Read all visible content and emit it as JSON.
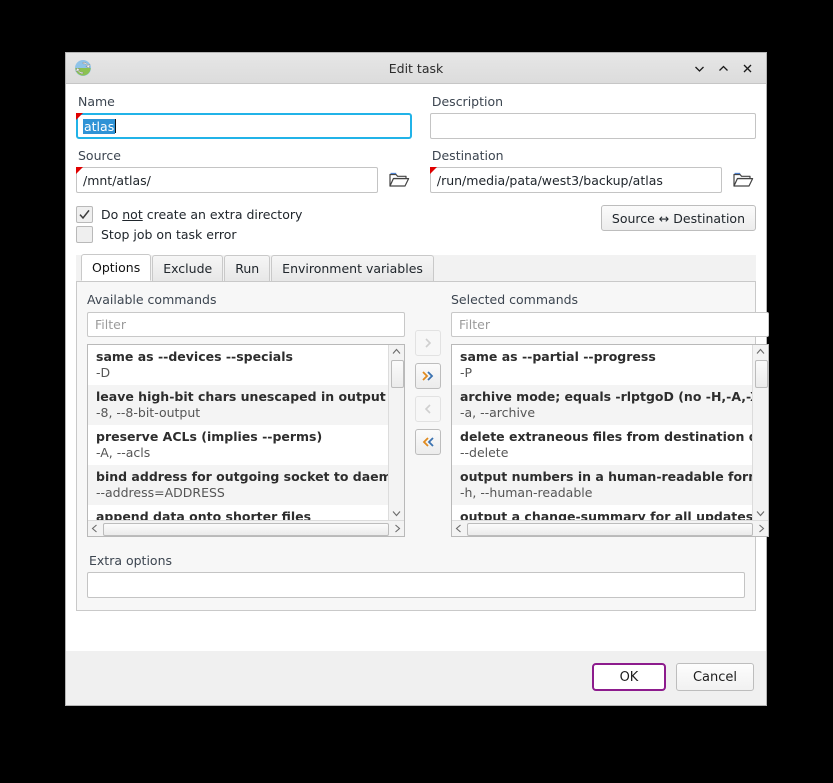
{
  "window": {
    "title": "Edit task",
    "icon": "sync-icon",
    "controls": [
      {
        "name": "minimize-button",
        "icon": "chevron-down-icon"
      },
      {
        "name": "maximize-button",
        "icon": "chevron-up-icon"
      },
      {
        "name": "close-button",
        "icon": "close-icon"
      }
    ]
  },
  "form": {
    "name": {
      "label": "Name",
      "value": "atlas",
      "selected": true,
      "focused": true,
      "modified_marker": true
    },
    "description": {
      "label": "Description",
      "value": "",
      "placeholder": ""
    },
    "source": {
      "label": "Source",
      "value": "/mnt/atlas/",
      "browse_icon": "folder-open-icon",
      "modified_marker": true
    },
    "destination": {
      "label": "Destination",
      "value": "/run/media/pata/west3/backup/atlas",
      "browse_icon": "folder-open-icon",
      "modified_marker": true
    },
    "checkboxes": [
      {
        "name": "no-extra-directory",
        "label_pre": "Do ",
        "label_underline": "not",
        "label_post": " create an extra directory",
        "checked": true
      },
      {
        "name": "stop-on-error",
        "label_pre": "Stop job on task error",
        "label_underline": "",
        "label_post": "",
        "checked": false
      }
    ],
    "swap_button": "Source ↔ Destination",
    "extra_options": {
      "label": "Extra options",
      "value": ""
    }
  },
  "tabs": [
    {
      "label": "Options",
      "active": true
    },
    {
      "label": "Exclude",
      "active": false
    },
    {
      "label": "Run",
      "active": false
    },
    {
      "label": "Environment variables",
      "active": false
    }
  ],
  "options_panel": {
    "available": {
      "label": "Available commands",
      "filter_placeholder": "Filter",
      "filter_value": "",
      "items": [
        {
          "title": "same as --devices --specials",
          "flags": "-D"
        },
        {
          "title": "leave high-bit chars unescaped in output",
          "flags": "-8, --8-bit-output"
        },
        {
          "title": "preserve ACLs (implies --perms)",
          "flags": "-A, --acls"
        },
        {
          "title": "bind address for outgoing socket to daemon",
          "flags": "--address=ADDRESS"
        },
        {
          "title": "append data onto shorter files",
          "flags": ""
        }
      ]
    },
    "selected": {
      "label": "Selected commands",
      "filter_placeholder": "Filter",
      "filter_value": "",
      "items": [
        {
          "title": "same as --partial --progress",
          "flags": "-P"
        },
        {
          "title": "archive mode; equals -rlptgoD (no -H,-A,-X)",
          "flags": "-a, --archive"
        },
        {
          "title": "delete extraneous files from destination dirs",
          "flags": "--delete"
        },
        {
          "title": "output numbers in a human-readable format",
          "flags": "-h, --human-readable"
        },
        {
          "title": "output a change-summary for all updates",
          "flags": ""
        }
      ]
    },
    "transfer_buttons": [
      {
        "name": "add-one-button",
        "glyph": "›",
        "enabled": false
      },
      {
        "name": "add-all-button",
        "glyph": "»",
        "enabled": true
      },
      {
        "name": "remove-one-button",
        "glyph": "‹",
        "enabled": false
      },
      {
        "name": "remove-all-button",
        "glyph": "«",
        "enabled": true
      }
    ]
  },
  "footer": {
    "ok_label": "OK",
    "cancel_label": "Cancel",
    "default_button": "OK"
  },
  "colors": {
    "accent_focus": "#21b3e8",
    "selection": "#2f93d6",
    "default_button_border": "#8d1c8d",
    "modified_marker": "#e00000",
    "arrow_enabled": "#e08a1e"
  }
}
